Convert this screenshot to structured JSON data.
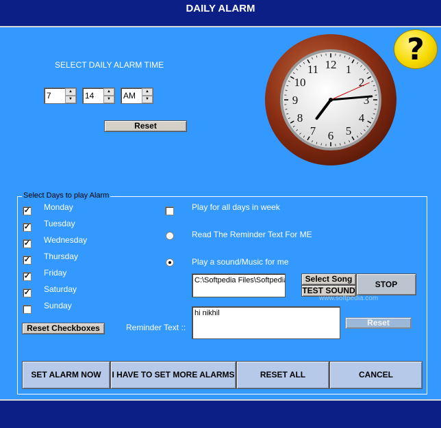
{
  "window": {
    "title": "DAILY ALARM"
  },
  "help": {
    "icon": "help-icon",
    "glyph": "?"
  },
  "time_selector": {
    "label": "SELECT DAILY ALARM TIME",
    "hour": "7",
    "minute": "14",
    "ampm": "AM",
    "reset_label": "Reset"
  },
  "clock": {
    "numerals": [
      "12",
      "1",
      "2",
      "3",
      "4",
      "5",
      "6",
      "7",
      "8",
      "9",
      "10",
      "11"
    ],
    "hour": 7,
    "minute": 14,
    "second": 11
  },
  "days_group": {
    "legend": "Select Days to play Alarm",
    "days": [
      {
        "label": "Monday",
        "checked": true
      },
      {
        "label": "Tuesday",
        "checked": true
      },
      {
        "label": "Wednesday",
        "checked": true
      },
      {
        "label": "Thursday",
        "checked": true
      },
      {
        "label": "Friday",
        "checked": true
      },
      {
        "label": "Saturday",
        "checked": true
      },
      {
        "label": "Sunday",
        "checked": false
      }
    ],
    "reset_checkboxes_label": "Reset Checkboxes",
    "play_all_days_label": "Play for all days in week",
    "read_reminder_label": "Read The Reminder Text For ME",
    "play_sound_label": "Play a sound/Music for me",
    "song_path": "C:\\Softpedia Files\\Softpedia",
    "select_song_label": "Select Song",
    "test_sound_label": "TEST SOUND",
    "stop_label": "STOP",
    "reminder_label": "Reminder Text ::",
    "reminder_text": "hi nikhil",
    "reminder_reset_label": "Reset"
  },
  "actions": {
    "set_alarm_now": "SET ALARM NOW",
    "set_more_alarms": "I HAVE TO SET MORE ALARMS",
    "reset_all": "RESET ALL",
    "cancel": "CANCEL"
  },
  "watermark": {
    "logo_text": "SOFTPEDIA",
    "url": "www.softpedia.com"
  },
  "colors": {
    "background": "#3399ff",
    "title_bar": "#0b1f86",
    "clock_frame": "#8a2e14",
    "second_hand": "#cc0000"
  }
}
